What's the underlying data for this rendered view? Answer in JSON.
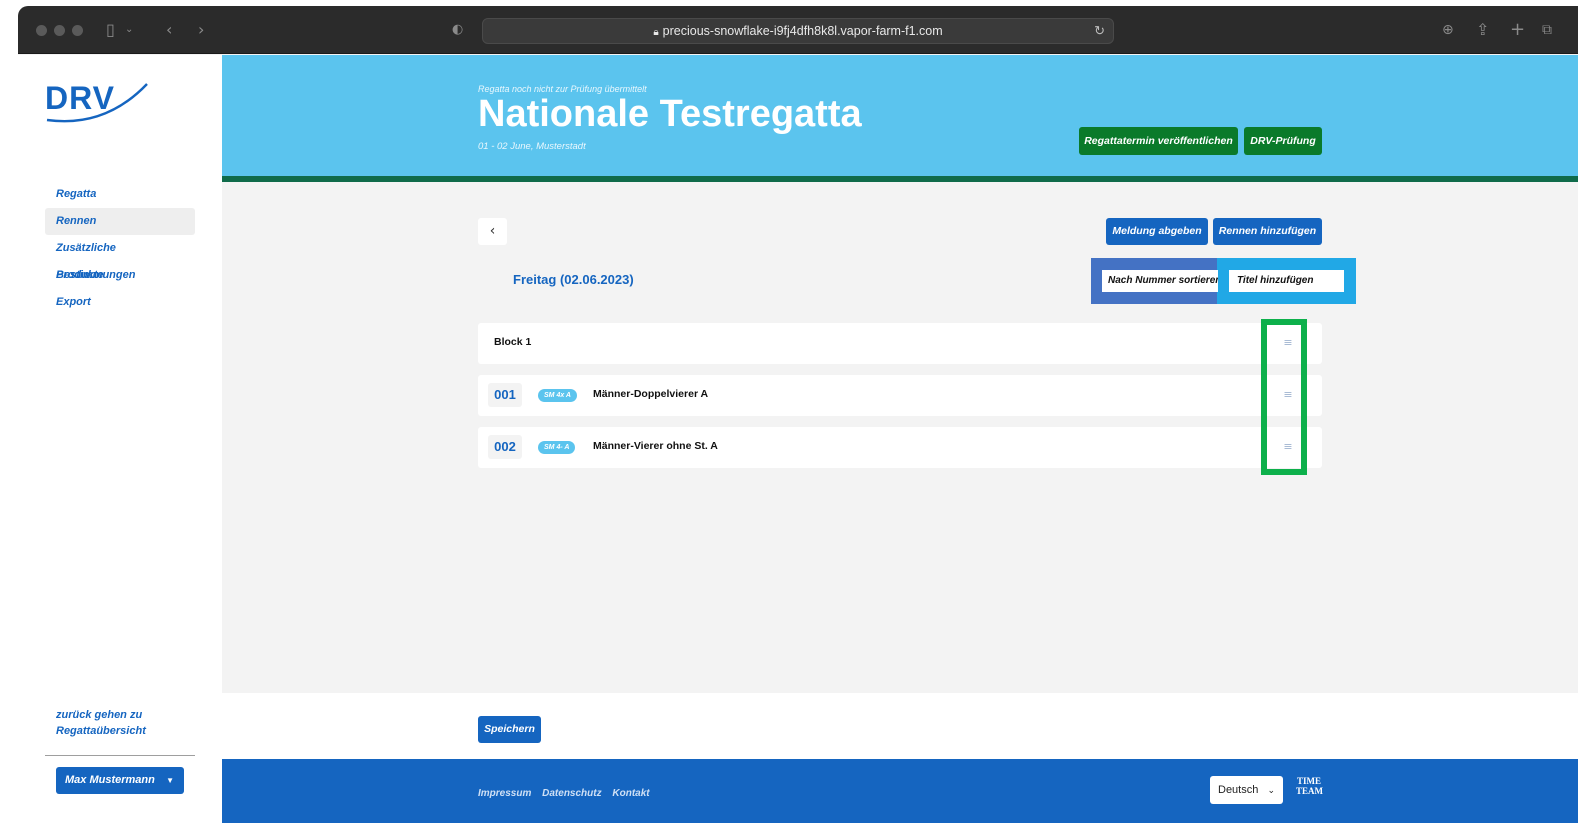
{
  "browser": {
    "url": "precious-snowflake-i9fj4dfh8k8l.vapor-farm-f1.com"
  },
  "sidebar": {
    "logo_text": "DRV",
    "items": [
      {
        "label": "Regatta"
      },
      {
        "label": "Rennen"
      },
      {
        "label": "Zusätzliche Bestimmungen"
      },
      {
        "label": "Produkte"
      },
      {
        "label": "Export"
      }
    ],
    "back_link": "zurück gehen zu Regattaübersicht",
    "user": "Max Mustermann"
  },
  "header": {
    "status": "Regatta noch nicht zur Prüfung übermittelt",
    "title": "Nationale Testregatta",
    "date": "01 - 02 June,  Musterstadt",
    "publish_button": "Regattatermin veröffentlichen",
    "review_button": "DRV-Prüfung"
  },
  "toolbar": {
    "submit_button": "Meldung abgeben",
    "add_race_button": "Rennen hinzufügen",
    "sort_button": "Nach Nummer sortieren",
    "add_title_button": "Titel hinzufügen"
  },
  "day": {
    "title": "Freitag (02.06.2023)"
  },
  "rows": [
    {
      "type": "block",
      "label": "Block 1"
    },
    {
      "type": "race",
      "number": "001",
      "tag": "SM 4x A",
      "name": "Männer-Doppelvierer A"
    },
    {
      "type": "race",
      "number": "002",
      "tag": "SM 4- A",
      "name": "Männer-Vierer ohne St. A"
    }
  ],
  "save_button": "Speichern",
  "footer": {
    "links": [
      "Impressum",
      "Datenschutz",
      "Kontakt"
    ],
    "language": "Deutsch",
    "logo_text": "TIME TEAM"
  },
  "colors": {
    "primary": "#1565c0",
    "banner": "#5bc4ee",
    "green": "#0a7a2a"
  }
}
